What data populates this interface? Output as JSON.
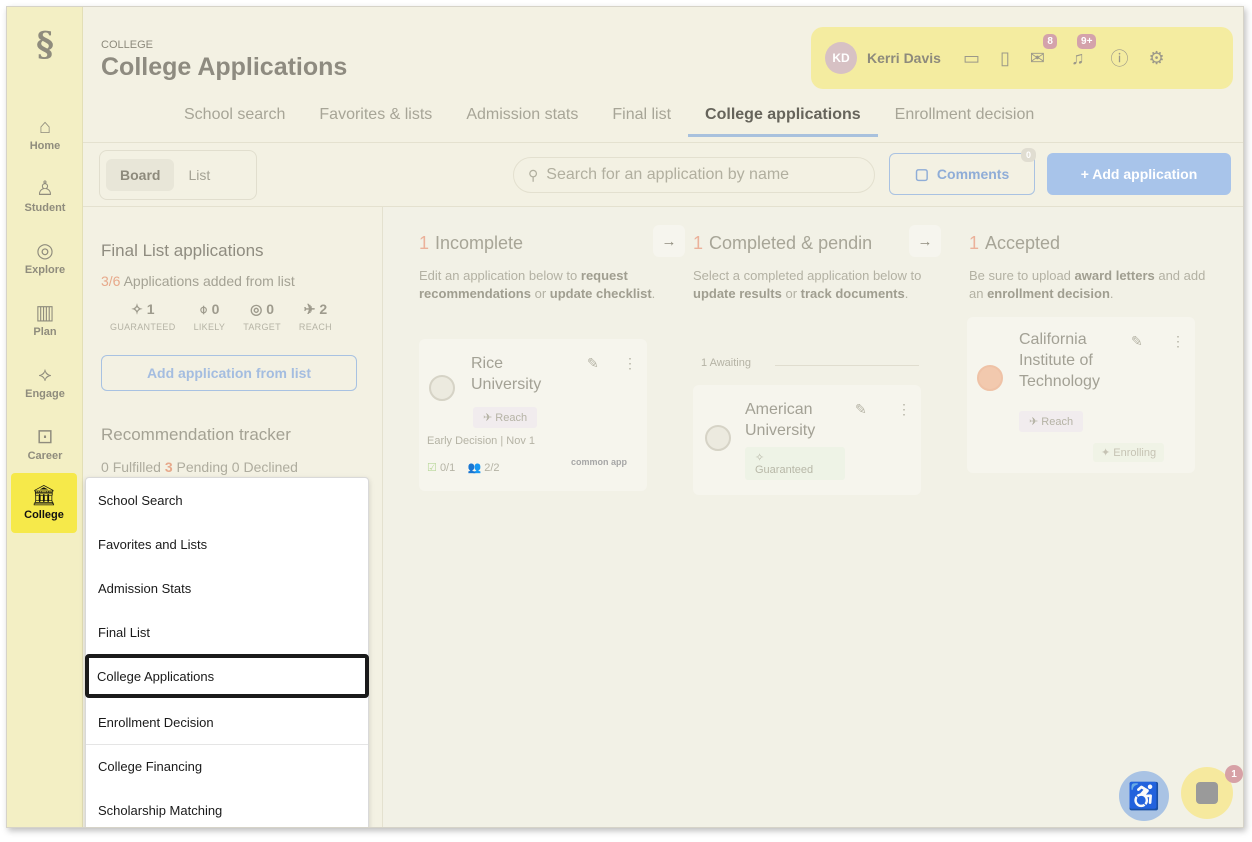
{
  "sidebar": {
    "logo": "§",
    "items": [
      {
        "label": "Home",
        "icon": "home-icon",
        "glyph": "⌂"
      },
      {
        "label": "Student",
        "icon": "student-icon",
        "glyph": "♙"
      },
      {
        "label": "Explore",
        "icon": "compass-icon",
        "glyph": "◎"
      },
      {
        "label": "Plan",
        "icon": "map-icon",
        "glyph": "▥"
      },
      {
        "label": "Engage",
        "icon": "handshake-icon",
        "glyph": "⟡"
      },
      {
        "label": "Career",
        "icon": "briefcase-icon",
        "glyph": "⊡"
      },
      {
        "label": "College",
        "icon": "college-icon",
        "glyph": "🏛"
      }
    ]
  },
  "header": {
    "eyebrow": "COLLEGE",
    "title": "College Applications",
    "user": {
      "initials": "KD",
      "name": "Kerri Davis",
      "mail_badge": "8",
      "bell_badge": "9+"
    },
    "tabs": [
      "School search",
      "Favorites & lists",
      "Admission stats",
      "Final list",
      "College applications",
      "Enrollment decision"
    ],
    "active_tab": "College applications"
  },
  "toolbar": {
    "view_board": "Board",
    "view_list": "List",
    "search_placeholder": "Search for an application by name",
    "comments_label": "Comments",
    "comments_count": "0",
    "add_label": "+  Add application"
  },
  "final_list": {
    "title": "Final List applications",
    "added_count": "3/6",
    "added_text": " Applications added from list",
    "categories": [
      {
        "icon": "✧",
        "value": "1",
        "label": "GUARANTEED"
      },
      {
        "icon": "⌽",
        "value": "0",
        "label": "LIKELY"
      },
      {
        "icon": "◎",
        "value": "0",
        "label": "TARGET"
      },
      {
        "icon": "✈",
        "value": "2",
        "label": "REACH"
      }
    ],
    "add_button": "Add application from list"
  },
  "recommendations": {
    "title": "Recommendation tracker",
    "fulfilled": "0",
    "fulfilled_label": "Fulfilled",
    "pending": "3",
    "pending_label": "Pending",
    "declined": "0",
    "declined_label": "Declined"
  },
  "board": {
    "incomplete": {
      "count": "1",
      "title": "Incomplete",
      "desc_pre": "Edit an application below to ",
      "desc_b1": "request recommendations",
      "desc_mid": " or ",
      "desc_b2": "update checklist",
      "desc_end": ".",
      "card": {
        "name_line1": "Rice",
        "name_line2": "University",
        "tag": "Reach",
        "deadline": "Early Decision | Nov 1",
        "checklist": "0/1",
        "recs": "2/2",
        "platform": "common app"
      }
    },
    "completed": {
      "count": "1",
      "title": "Completed & pendin",
      "desc_pre": "Select a completed application below to ",
      "desc_b1": "update results",
      "desc_mid": " or ",
      "desc_b2": "track documents",
      "desc_end": ".",
      "group": "1 Awaiting",
      "card": {
        "name_line1": "American",
        "name_line2": "University",
        "tag": "Guaranteed"
      }
    },
    "accepted": {
      "count": "1",
      "title": "Accepted",
      "desc_pre": "Be sure to upload ",
      "desc_b1": "award letters",
      "desc_mid": " and add an ",
      "desc_b2": "enrollment decision",
      "desc_end": ".",
      "card": {
        "name_line1": "California",
        "name_line2": "Institute of",
        "name_line3": "Technology",
        "tag": "Reach",
        "status": "Enrolling"
      }
    }
  },
  "dropdown": {
    "items": [
      "School Search",
      "Favorites and Lists",
      "Admission Stats",
      "Final List",
      "College Applications",
      "Enrollment Decision",
      "College Financing",
      "Scholarship Matching"
    ],
    "selected": "College Applications"
  },
  "floating": {
    "chat_badge": "1"
  }
}
